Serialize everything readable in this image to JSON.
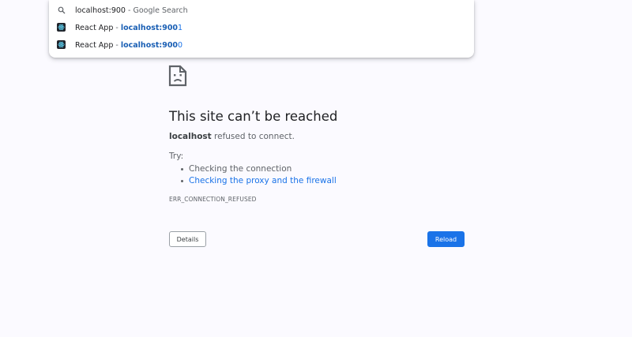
{
  "omnibox": {
    "suggestions": [
      {
        "icon": "search-icon",
        "query": "localhost:900",
        "separator": " - ",
        "source": "Google Search"
      },
      {
        "icon": "react-favicon-icon",
        "title": "React App",
        "separator": " - ",
        "url_match": "localhost:900",
        "url_rest": "1"
      },
      {
        "icon": "react-favicon-icon",
        "title": "React App",
        "separator": " - ",
        "url_match": "localhost:900",
        "url_rest": "0"
      }
    ]
  },
  "error": {
    "icon": "sad-page-icon",
    "title": "This site can’t be reached",
    "host": "localhost",
    "message": " refused to connect.",
    "try_label": "Try:",
    "suggestions": [
      {
        "text": "Checking the connection",
        "is_link": false
      },
      {
        "text": "Checking the proxy and the firewall",
        "is_link": true
      }
    ],
    "code": "ERR_CONNECTION_REFUSED"
  },
  "buttons": {
    "details": "Details",
    "reload": "Reload"
  },
  "colors": {
    "background": "#fbfaff",
    "link": "#1a73e8",
    "primary_button": "#1a73e8",
    "title": "#202124"
  }
}
